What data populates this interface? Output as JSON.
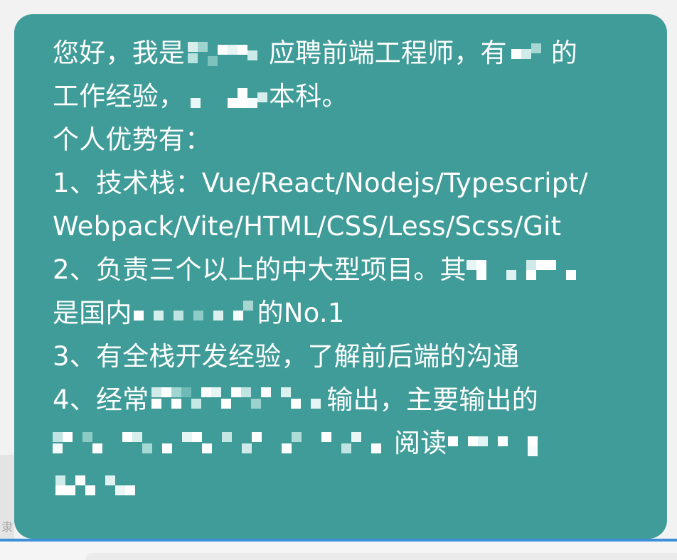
{
  "message": {
    "lines": [
      [
        "您好，我是",
        "应聘前端工程师，有",
        "的"
      ],
      [
        "工作经验，",
        "本科。"
      ],
      [
        "个人优势有："
      ],
      [
        "1、技术栈：Vue/React/Nodejs/Typescript/"
      ],
      [
        "Webpack/Vite/HTML/CSS/Less/Scss/Git"
      ],
      [
        "2、负责三个以上的中大型项目。其"
      ],
      [
        "是国内",
        "的No.1"
      ],
      [
        "3、有全栈开发经验，了解前后端的沟通"
      ],
      [
        "4、经常",
        "输出，主要输出的"
      ],
      [
        "",
        "阅读"
      ],
      [
        ""
      ]
    ]
  },
  "sidebar": {
    "edge_text": "隶"
  },
  "colors": {
    "bubble": "#3f9c98",
    "text": "#ffffff",
    "background": "#f2f2f2",
    "divider": "#3d8fd8"
  }
}
